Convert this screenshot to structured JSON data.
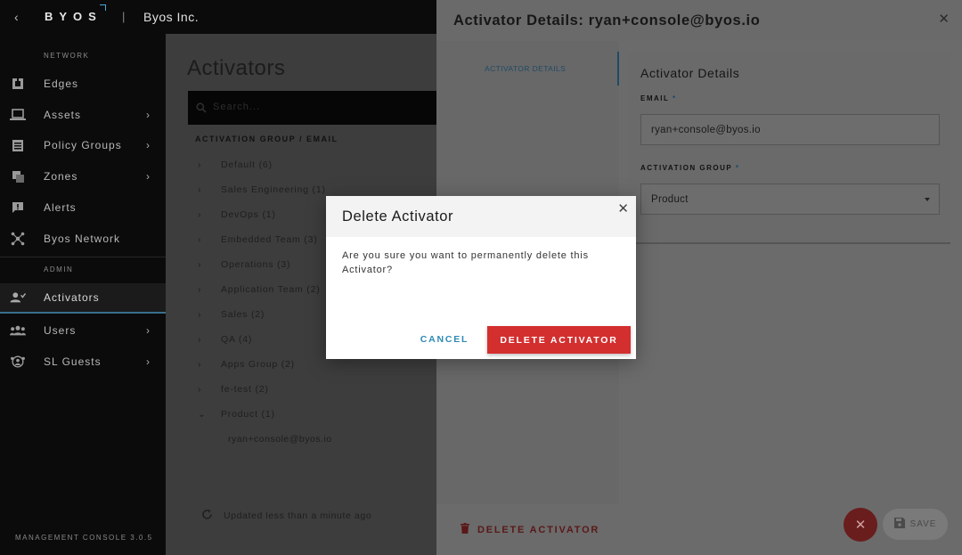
{
  "app": {
    "logo_text": "BYOS",
    "separator": "|",
    "org_name": "Byos Inc.",
    "version": "MANAGEMENT CONSOLE 3.0.5"
  },
  "sidebar": {
    "network_label": "NETWORK",
    "admin_label": "ADMIN",
    "network_items": [
      {
        "label": "Edges",
        "icon": "edges-icon",
        "has_submenu": false
      },
      {
        "label": "Assets",
        "icon": "laptop-icon",
        "has_submenu": true
      },
      {
        "label": "Policy Groups",
        "icon": "policy-icon",
        "has_submenu": true
      },
      {
        "label": "Zones",
        "icon": "zones-icon",
        "has_submenu": true
      },
      {
        "label": "Alerts",
        "icon": "alert-icon",
        "has_submenu": false
      },
      {
        "label": "Byos Network",
        "icon": "network-icon",
        "has_submenu": false
      }
    ],
    "admin_items": [
      {
        "label": "Activators",
        "icon": "activators-icon",
        "has_submenu": false,
        "active": true
      },
      {
        "label": "Users",
        "icon": "users-icon",
        "has_submenu": true
      },
      {
        "label": "SL Guests",
        "icon": "guests-icon",
        "has_submenu": true
      }
    ]
  },
  "main": {
    "title": "Activators",
    "search_placeholder": "Search...",
    "column_header": "ACTIVATION GROUP / EMAIL",
    "groups": [
      {
        "label": "Default (6)",
        "expanded": false
      },
      {
        "label": "Sales Engineering (1)",
        "expanded": false
      },
      {
        "label": "DevOps (1)",
        "expanded": false
      },
      {
        "label": "Embedded Team (3)",
        "expanded": false
      },
      {
        "label": "Operations (3)",
        "expanded": false
      },
      {
        "label": "Application Team (2)",
        "expanded": false
      },
      {
        "label": "Sales (2)",
        "expanded": false
      },
      {
        "label": "QA (4)",
        "expanded": false
      },
      {
        "label": "Apps Group (2)",
        "expanded": false
      },
      {
        "label": "fe-test (2)",
        "expanded": false
      },
      {
        "label": "Product (1)",
        "expanded": true
      }
    ],
    "expanded_child": "ryan+console@byos.io",
    "updated_text": "Updated less than a minute ago"
  },
  "drawer": {
    "title": "Activator Details: ryan+console@byos.io",
    "nav_item": "ACTIVATOR DETAILS",
    "section_heading": "Activator Details",
    "email_label": "EMAIL",
    "email_value": "ryan+console@byos.io",
    "group_label": "ACTIVATION GROUP",
    "group_value": "Product",
    "required_mark": "*",
    "footer_delete_label": "DELETE ACTIVATOR",
    "save_label": "SAVE"
  },
  "modal": {
    "title": "Delete Activator",
    "message": "Are you sure you want to permanently delete this Activator?",
    "cancel_label": "CANCEL",
    "confirm_label": "DELETE ACTIVATOR"
  },
  "colors": {
    "accent": "#2f8ab5",
    "danger": "#d32f2f",
    "sidebar_bg": "#0b0b0b"
  }
}
